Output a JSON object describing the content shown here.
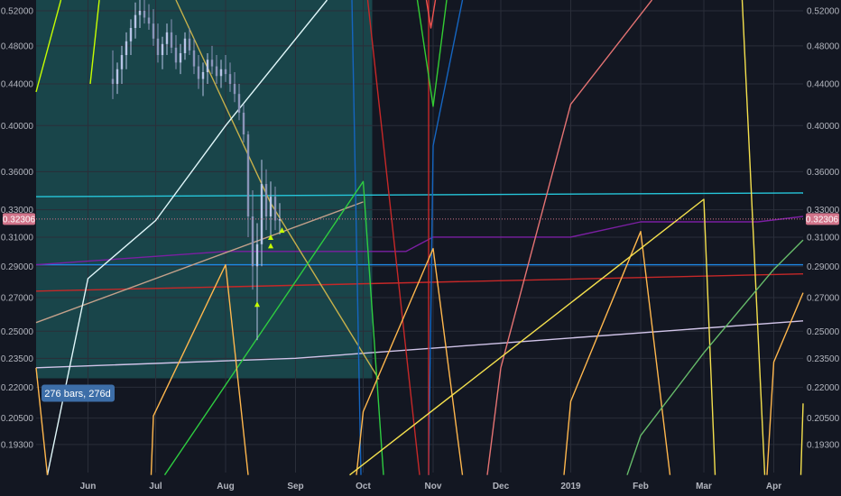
{
  "chart_data": {
    "type": "line",
    "title": "",
    "xlabel": "",
    "ylabel": "",
    "y_scale": "log",
    "ylim": [
      0.181,
      0.533
    ],
    "xlim": [
      "2018-05-09",
      "2019-04-14"
    ],
    "grid": true,
    "y_ticks": [
      0.52,
      0.48,
      0.44,
      0.4,
      0.36,
      0.33,
      0.31,
      0.29,
      0.27,
      0.25,
      0.235,
      0.22,
      0.205,
      0.193
    ],
    "y_tick_labels": [
      "0.52000",
      "0.48000",
      "0.44000",
      "0.40000",
      "0.36000",
      "0.33000",
      "0.31000",
      "0.29000",
      "0.27000",
      "0.25000",
      "0.23500",
      "0.22000",
      "0.20500",
      "0.19300"
    ],
    "x_ticks": [
      {
        "date": "2018-06-01",
        "label": "Jun",
        "strong": false
      },
      {
        "date": "2018-07-01",
        "label": "Jul",
        "strong": false
      },
      {
        "date": "2018-08-01",
        "label": "Aug",
        "strong": false
      },
      {
        "date": "2018-09-01",
        "label": "Sep",
        "strong": false
      },
      {
        "date": "2018-10-01",
        "label": "Oct",
        "strong": false
      },
      {
        "date": "2018-11-01",
        "label": "Nov",
        "strong": false
      },
      {
        "date": "2018-12-01",
        "label": "Dec",
        "strong": false
      },
      {
        "date": "2019-01-01",
        "label": "2019",
        "strong": true
      },
      {
        "date": "2019-02-01",
        "label": "Feb",
        "strong": false
      },
      {
        "date": "2019-03-01",
        "label": "Mar",
        "strong": false
      },
      {
        "date": "2019-04-01",
        "label": "Apr",
        "strong": false
      }
    ],
    "current_price": {
      "value": 0.32306,
      "label": "0.32306",
      "color": "#d1748a"
    },
    "range_box": {
      "start": "2018-05-09",
      "end": "2018-10-05",
      "top": 0.533,
      "bottom": 0.2245,
      "label": "276 bars, 276d",
      "color": "#1f6b6b"
    },
    "candles": [
      {
        "date": "2018-06-12",
        "open": 0.445,
        "high": 0.475,
        "low": 0.425,
        "close": 0.44
      },
      {
        "date": "2018-06-14",
        "open": 0.44,
        "high": 0.462,
        "low": 0.43,
        "close": 0.455
      },
      {
        "date": "2018-06-16",
        "open": 0.455,
        "high": 0.48,
        "low": 0.44,
        "close": 0.47
      },
      {
        "date": "2018-06-18",
        "open": 0.47,
        "high": 0.495,
        "low": 0.455,
        "close": 0.485
      },
      {
        "date": "2018-06-20",
        "open": 0.485,
        "high": 0.51,
        "low": 0.47,
        "close": 0.5
      },
      {
        "date": "2018-06-22",
        "open": 0.5,
        "high": 0.53,
        "low": 0.488,
        "close": 0.515
      },
      {
        "date": "2018-06-24",
        "open": 0.515,
        "high": 0.533,
        "low": 0.5,
        "close": 0.52
      },
      {
        "date": "2018-06-26",
        "open": 0.52,
        "high": 0.533,
        "low": 0.505,
        "close": 0.512
      },
      {
        "date": "2018-06-28",
        "open": 0.512,
        "high": 0.528,
        "low": 0.498,
        "close": 0.505
      },
      {
        "date": "2018-06-30",
        "open": 0.505,
        "high": 0.522,
        "low": 0.48,
        "close": 0.488
      },
      {
        "date": "2018-07-02",
        "open": 0.488,
        "high": 0.505,
        "low": 0.462,
        "close": 0.47
      },
      {
        "date": "2018-07-04",
        "open": 0.47,
        "high": 0.49,
        "low": 0.455,
        "close": 0.482
      },
      {
        "date": "2018-07-06",
        "open": 0.482,
        "high": 0.505,
        "low": 0.47,
        "close": 0.495
      },
      {
        "date": "2018-07-08",
        "open": 0.495,
        "high": 0.51,
        "low": 0.472,
        "close": 0.478
      },
      {
        "date": "2018-07-10",
        "open": 0.478,
        "high": 0.492,
        "low": 0.455,
        "close": 0.462
      },
      {
        "date": "2018-07-12",
        "open": 0.462,
        "high": 0.482,
        "low": 0.45,
        "close": 0.472
      },
      {
        "date": "2018-07-14",
        "open": 0.472,
        "high": 0.495,
        "low": 0.465,
        "close": 0.488
      },
      {
        "date": "2018-07-16",
        "open": 0.488,
        "high": 0.5,
        "low": 0.47,
        "close": 0.475
      },
      {
        "date": "2018-07-18",
        "open": 0.475,
        "high": 0.488,
        "low": 0.45,
        "close": 0.458
      },
      {
        "date": "2018-07-20",
        "open": 0.458,
        "high": 0.47,
        "low": 0.435,
        "close": 0.445
      },
      {
        "date": "2018-07-22",
        "open": 0.445,
        "high": 0.462,
        "low": 0.428,
        "close": 0.452
      },
      {
        "date": "2018-07-24",
        "open": 0.452,
        "high": 0.472,
        "low": 0.44,
        "close": 0.465
      },
      {
        "date": "2018-07-26",
        "open": 0.465,
        "high": 0.48,
        "low": 0.45,
        "close": 0.458
      },
      {
        "date": "2018-07-28",
        "open": 0.458,
        "high": 0.47,
        "low": 0.44,
        "close": 0.448
      },
      {
        "date": "2018-07-30",
        "open": 0.448,
        "high": 0.465,
        "low": 0.436,
        "close": 0.455
      },
      {
        "date": "2018-08-01",
        "open": 0.455,
        "high": 0.47,
        "low": 0.442,
        "close": 0.45
      },
      {
        "date": "2018-08-03",
        "open": 0.45,
        "high": 0.462,
        "low": 0.432,
        "close": 0.44
      },
      {
        "date": "2018-08-05",
        "open": 0.44,
        "high": 0.452,
        "low": 0.422,
        "close": 0.43
      },
      {
        "date": "2018-08-07",
        "open": 0.43,
        "high": 0.44,
        "low": 0.405,
        "close": 0.412
      },
      {
        "date": "2018-08-09",
        "open": 0.412,
        "high": 0.42,
        "low": 0.385,
        "close": 0.392
      },
      {
        "date": "2018-08-11",
        "open": 0.392,
        "high": 0.395,
        "low": 0.31,
        "close": 0.325
      },
      {
        "date": "2018-08-13",
        "open": 0.325,
        "high": 0.345,
        "low": 0.275,
        "close": 0.29
      },
      {
        "date": "2018-08-15",
        "open": 0.29,
        "high": 0.32,
        "low": 0.245,
        "close": 0.305
      },
      {
        "date": "2018-08-17",
        "open": 0.305,
        "high": 0.37,
        "low": 0.29,
        "close": 0.35
      },
      {
        "date": "2018-08-19",
        "open": 0.35,
        "high": 0.362,
        "low": 0.315,
        "close": 0.325
      },
      {
        "date": "2018-08-21",
        "open": 0.325,
        "high": 0.352,
        "low": 0.31,
        "close": 0.34
      },
      {
        "date": "2018-08-23",
        "open": 0.34,
        "high": 0.348,
        "low": 0.315,
        "close": 0.322
      },
      {
        "date": "2018-08-25",
        "open": 0.322,
        "high": 0.335,
        "low": 0.312,
        "close": 0.323
      }
    ],
    "markers": [
      {
        "date": "2018-08-15",
        "value": 0.266
      },
      {
        "date": "2018-08-21",
        "value": 0.304
      },
      {
        "date": "2018-08-21",
        "value": 0.31
      },
      {
        "date": "2018-08-26",
        "value": 0.315
      }
    ],
    "series": [
      {
        "color": "#26c6da",
        "points": [
          [
            "2018-05-09",
            0.34
          ],
          [
            "2019-04-14",
            0.343
          ]
        ]
      },
      {
        "color": "#1e88e5",
        "points": [
          [
            "2018-05-09",
            0.291
          ],
          [
            "2019-04-14",
            0.291
          ]
        ]
      },
      {
        "color": "#7b1fa2",
        "points": [
          [
            "2018-05-09",
            0.291
          ],
          [
            "2018-08-01",
            0.3
          ],
          [
            "2018-10-20",
            0.3
          ],
          [
            "2018-11-01",
            0.31
          ],
          [
            "2019-01-01",
            0.31
          ],
          [
            "2019-02-01",
            0.321
          ],
          [
            "2019-03-25",
            0.321
          ],
          [
            "2019-04-14",
            0.325
          ]
        ]
      },
      {
        "color": "#c62828",
        "points": [
          [
            "2018-05-09",
            0.274
          ],
          [
            "2019-04-14",
            0.285
          ]
        ]
      },
      {
        "color": "#d1c4e9",
        "points": [
          [
            "2018-05-09",
            0.23
          ],
          [
            "2018-09-01",
            0.235
          ],
          [
            "2019-04-14",
            0.256
          ]
        ]
      },
      {
        "color": "#c2a08a",
        "points": [
          [
            "2018-05-09",
            0.255
          ],
          [
            "2018-10-01",
            0.336
          ]
        ]
      },
      {
        "color": "#c6b04a",
        "points": [
          [
            "2018-07-10",
            0.533
          ],
          [
            "2018-08-21",
            0.335
          ],
          [
            "2018-10-08",
            0.224
          ]
        ]
      },
      {
        "color": "#e0f7fa",
        "points": [
          [
            "2018-05-14",
            0.18
          ],
          [
            "2018-06-01",
            0.282
          ],
          [
            "2018-07-01",
            0.322
          ],
          [
            "2018-08-01",
            0.4
          ],
          [
            "2018-09-15",
            0.533
          ]
        ]
      },
      {
        "color": "#1565c0",
        "points": [
          [
            "2018-09-26",
            0.533
          ],
          [
            "2018-09-30",
            0.18
          ]
        ]
      },
      {
        "color": "#1565c0",
        "points": [
          [
            "2018-10-30",
            0.18
          ],
          [
            "2018-11-01",
            0.382
          ],
          [
            "2018-11-14",
            0.533
          ]
        ]
      },
      {
        "color": "#c62828",
        "points": [
          [
            "2018-10-03",
            0.533
          ],
          [
            "2018-10-26",
            0.18
          ]
        ]
      },
      {
        "color": "#c62828",
        "points": [
          [
            "2018-10-30",
            0.18
          ],
          [
            "2018-10-30",
            0.533
          ]
        ]
      },
      {
        "color": "#ef5350",
        "points": [
          [
            "2018-10-29",
            0.533
          ],
          [
            "2018-10-31",
            0.5
          ],
          [
            "2018-11-02",
            0.533
          ]
        ]
      },
      {
        "color": "#33cc33",
        "points": [
          [
            "2018-10-25",
            0.533
          ],
          [
            "2018-11-01",
            0.418
          ],
          [
            "2018-11-07",
            0.533
          ]
        ]
      },
      {
        "color": "#2ecc40",
        "points": [
          [
            "2018-07-05",
            0.18
          ],
          [
            "2018-10-01",
            0.352
          ],
          [
            "2018-10-10",
            0.18
          ]
        ]
      },
      {
        "color": "#ffb74d",
        "points": [
          [
            "2018-05-09",
            0.23
          ],
          [
            "2018-05-14",
            0.18
          ]
        ]
      },
      {
        "color": "#ffb74d",
        "points": [
          [
            "2018-06-29",
            0.18
          ],
          [
            "2018-06-30",
            0.206
          ],
          [
            "2018-08-01",
            0.291
          ],
          [
            "2018-08-11",
            0.18
          ]
        ]
      },
      {
        "color": "#ffb74d",
        "points": [
          [
            "2018-09-28",
            0.18
          ],
          [
            "2018-10-01",
            0.208
          ],
          [
            "2018-11-01",
            0.302
          ],
          [
            "2018-11-14",
            0.18
          ]
        ]
      },
      {
        "color": "#ffb74d",
        "points": [
          [
            "2018-12-29",
            0.18
          ],
          [
            "2019-01-01",
            0.213
          ],
          [
            "2019-02-01",
            0.314
          ],
          [
            "2019-02-14",
            0.18
          ]
        ]
      },
      {
        "color": "#ffb74d",
        "points": [
          [
            "2019-03-29",
            0.18
          ],
          [
            "2019-04-01",
            0.233
          ],
          [
            "2019-04-14",
            0.273
          ]
        ]
      },
      {
        "color": "#e57373",
        "points": [
          [
            "2018-11-25",
            0.18
          ],
          [
            "2018-12-01",
            0.23
          ],
          [
            "2019-01-01",
            0.42
          ],
          [
            "2019-02-06",
            0.533
          ]
        ]
      },
      {
        "color": "#f4e04d",
        "points": [
          [
            "2018-09-25",
            0.18
          ],
          [
            "2019-03-01",
            0.338
          ],
          [
            "2019-03-06",
            0.18
          ]
        ]
      },
      {
        "color": "#f4e04d",
        "points": [
          [
            "2019-03-18",
            0.533
          ],
          [
            "2019-03-28",
            0.18
          ]
        ]
      },
      {
        "color": "#f4e04d",
        "points": [
          [
            "2019-04-13",
            0.18
          ],
          [
            "2019-04-14",
            0.212
          ]
        ]
      },
      {
        "color": "#c6ff00",
        "points": [
          [
            "2018-05-09",
            0.432
          ],
          [
            "2018-05-20",
            0.533
          ]
        ]
      },
      {
        "color": "#c6ff00",
        "points": [
          [
            "2018-06-02",
            0.44
          ],
          [
            "2018-06-06",
            0.533
          ]
        ]
      },
      {
        "color": "#66bb6a",
        "points": [
          [
            "2019-01-26",
            0.18
          ],
          [
            "2019-02-01",
            0.197
          ],
          [
            "2019-03-01",
            0.238
          ],
          [
            "2019-04-01",
            0.288
          ],
          [
            "2019-04-14",
            0.308
          ]
        ]
      }
    ]
  }
}
